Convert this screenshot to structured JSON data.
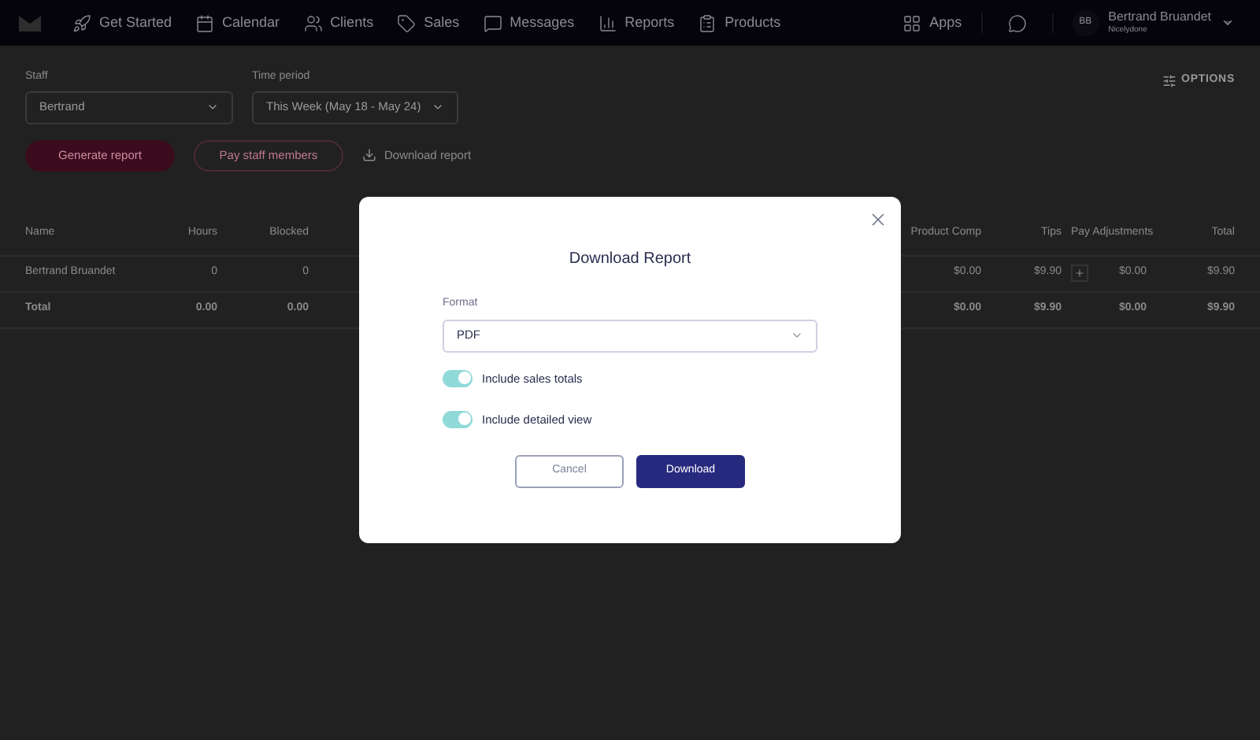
{
  "nav": {
    "items": [
      {
        "label": "Get Started"
      },
      {
        "label": "Calendar"
      },
      {
        "label": "Clients"
      },
      {
        "label": "Sales"
      },
      {
        "label": "Messages"
      },
      {
        "label": "Reports"
      },
      {
        "label": "Products"
      }
    ],
    "apps": "Apps",
    "user": {
      "initials": "BB",
      "name": "Bertrand Bruandet",
      "business": "Nicelydone"
    }
  },
  "filters": {
    "staff": {
      "label": "Staff",
      "value": "Bertrand"
    },
    "time_period": {
      "label": "Time period",
      "value": "This Week (May 18 - May 24)"
    },
    "options": "OPTIONS"
  },
  "actions": {
    "generate": "Generate report",
    "pay": "Pay staff members",
    "download": "Download report"
  },
  "table": {
    "columns": [
      "Name",
      "Hours",
      "Blocked",
      "Product Comp",
      "Tips",
      "Pay Adjustments",
      "Total"
    ],
    "rows": [
      {
        "kind": "staff",
        "cells": [
          "Bertrand Bruandet",
          "0",
          "0",
          "$0.00",
          "$9.90",
          "$0.00",
          "$9.90"
        ]
      },
      {
        "kind": "total",
        "cells": [
          "Total",
          "0.00",
          "0.00",
          "$0.00",
          "$9.90",
          "$0.00",
          "$9.90"
        ]
      }
    ]
  },
  "dialog": {
    "title": "Download Report",
    "format_label": "Format",
    "format_value": "PDF",
    "toggles": [
      {
        "label": "Include sales totals",
        "on": true
      },
      {
        "label": "Include detailed view",
        "on": true
      }
    ],
    "cancel": "Cancel",
    "confirm": "Download"
  }
}
